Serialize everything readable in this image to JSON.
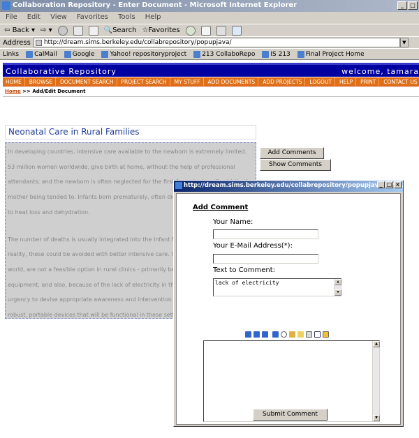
{
  "browser": {
    "window_title": "Collaboration Repository - Enter Document - Microsoft Internet Explorer",
    "menu": [
      "File",
      "Edit",
      "View",
      "Favorites",
      "Tools",
      "Help"
    ],
    "toolbar": {
      "back": "Back",
      "search": "Search",
      "favorites": "Favorites"
    },
    "address_label": "Address",
    "address_url": "http://dream.sims.berkeley.edu/collabrepository/popupjava/",
    "links_label": "Links",
    "links": [
      "CalMail",
      "Google",
      "Yahoo! repositoryproject",
      "213 CollaboRepo",
      "IS 213",
      "Final Project Home"
    ]
  },
  "site": {
    "title": "Collaborative Repository",
    "welcome": "welcome, tamara",
    "nav": [
      "HOME",
      "BROWSE",
      "DOCUMENT SEARCH",
      "PROJECT SEARCH",
      "MY STUFF",
      "ADD DOCUMENTS",
      "ADD PROJECTS",
      "LOGOUT",
      "HELP",
      "PRINT",
      "CONTACT US"
    ],
    "breadcrumb_home": "Home",
    "breadcrumb_rest": " >> Add/Edit Document"
  },
  "document": {
    "title": "Neonatal Care in Rural Families",
    "paragraph1": "In developing countries, intensive care available to the newborn is extremely limited. 53 million women worldwide, give birth at home, without the help of professional attendants; and the newborn is often neglected for the first few minutes after birth, the mother being tended to. Infants born prematurely, often die within hours of birth, due to heat loss and dehydration.",
    "paragraph2": "The number of deaths is usually integrated into the Infant Mortality Rate, when in reality, these could be avoided with better intensive care. Incubators, as in the western world, are not a feasible option in rural clinics - primarily because they can't afford the equipment, and also, because of the lack of electricity in these areas. There is thus an urgency to devise appropriate awareness and intervention strategies, and to design robust, portable devices that will be functional in these settings."
  },
  "buttons": {
    "add_comments": "Add Comments",
    "show_comments": "Show Comments"
  },
  "popup": {
    "title": "http://dream.sims.berkeley.edu/collabrepository/popupjava/ - Mi...",
    "heading": "Add Comment",
    "name_label": "Your Name:",
    "email_label": "Your E-Mail Address(*):",
    "text_label": "Text to Comment:",
    "text_value": "lack of electricity",
    "submit": "Submit Comment"
  }
}
